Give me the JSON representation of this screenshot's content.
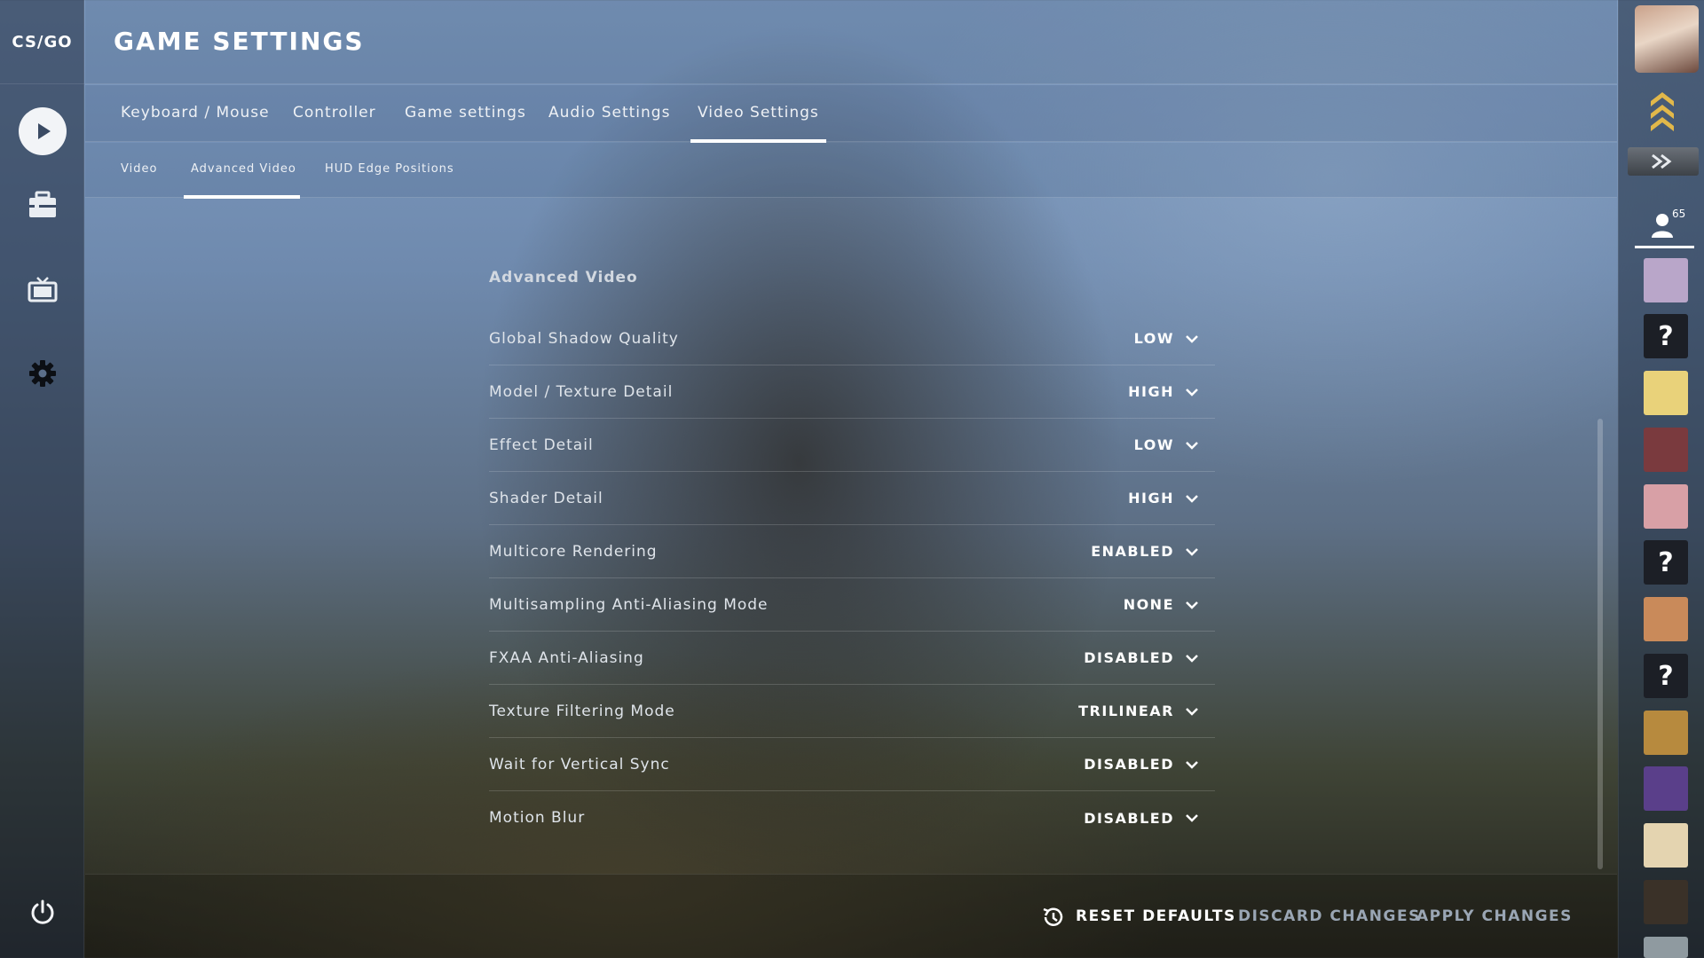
{
  "app": {
    "logo": "CS/GO",
    "title": "GAME SETTINGS"
  },
  "sidebar": {
    "items": [
      {
        "icon": "play-icon"
      },
      {
        "icon": "inventory-icon"
      },
      {
        "icon": "watch-tv-icon"
      },
      {
        "icon": "gear-icon"
      }
    ],
    "power_icon": "power-icon"
  },
  "tabs": [
    {
      "label": "Keyboard / Mouse",
      "active": false
    },
    {
      "label": "Controller",
      "active": false
    },
    {
      "label": "Game settings",
      "active": false
    },
    {
      "label": "Audio Settings",
      "active": false
    },
    {
      "label": "Video Settings",
      "active": true
    }
  ],
  "subtabs": [
    {
      "label": "Video",
      "active": false
    },
    {
      "label": "Advanced Video",
      "active": true
    },
    {
      "label": "HUD Edge Positions",
      "active": false
    }
  ],
  "section": {
    "title": "Advanced Video"
  },
  "settings": [
    {
      "label": "Global Shadow Quality",
      "value": "LOW"
    },
    {
      "label": "Model / Texture Detail",
      "value": "HIGH"
    },
    {
      "label": "Effect Detail",
      "value": "LOW"
    },
    {
      "label": "Shader Detail",
      "value": "HIGH"
    },
    {
      "label": "Multicore Rendering",
      "value": "ENABLED"
    },
    {
      "label": "Multisampling Anti-Aliasing Mode",
      "value": "NONE"
    },
    {
      "label": "FXAA Anti-Aliasing",
      "value": "DISABLED"
    },
    {
      "label": "Texture Filtering Mode",
      "value": "TRILINEAR"
    },
    {
      "label": "Wait for Vertical Sync",
      "value": "DISABLED"
    },
    {
      "label": "Motion Blur",
      "value": "DISABLED"
    }
  ],
  "footer": {
    "reset_label": "RESET DEFAULTS",
    "discard_label": "DISCARD CHANGES",
    "apply_label": "APPLY CHANGES"
  },
  "friends": {
    "count": "65",
    "list": [
      {
        "type": "avatar",
        "color": "#b9a6c9"
      },
      {
        "type": "unknown",
        "label": "?"
      },
      {
        "type": "avatar",
        "color": "#e9d27a"
      },
      {
        "type": "avatar",
        "color": "#7a3a3e"
      },
      {
        "type": "avatar",
        "color": "#d8a0a6"
      },
      {
        "type": "unknown",
        "label": "?"
      },
      {
        "type": "avatar",
        "color": "#c98a5a"
      },
      {
        "type": "unknown",
        "label": "?"
      },
      {
        "type": "avatar",
        "color": "#b78a3e"
      },
      {
        "type": "avatar",
        "color": "#5a3f8a"
      },
      {
        "type": "avatar",
        "color": "#e4d4b0"
      },
      {
        "type": "avatar",
        "color": "#3a3128"
      },
      {
        "type": "avatar",
        "color": "#8f9aa0"
      }
    ]
  },
  "colors": {
    "accent": "#ffffff",
    "muted_button": "#9aa6b4"
  }
}
